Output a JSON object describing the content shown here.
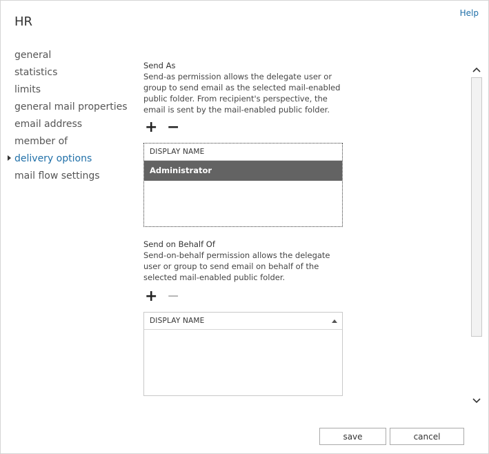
{
  "help_label": "Help",
  "title": "HR",
  "nav": {
    "items": [
      {
        "label": "general"
      },
      {
        "label": "statistics"
      },
      {
        "label": "limits"
      },
      {
        "label": "general mail properties"
      },
      {
        "label": "email address"
      },
      {
        "label": "member of"
      },
      {
        "label": "delivery options"
      },
      {
        "label": "mail flow settings"
      }
    ],
    "active": "delivery options"
  },
  "send_as": {
    "title": "Send As",
    "description": "Send-as permission allows the delegate user or group to send email as the selected mail-enabled public folder. From recipient's perspective, the email is sent by the mail-enabled public folder.",
    "add_glyph": "+",
    "remove_glyph": "−",
    "column_header": "DISPLAY NAME",
    "rows": [
      "Administrator"
    ]
  },
  "send_on_behalf": {
    "title": "Send on Behalf Of",
    "description": "Send-on-behalf permission allows the delegate user or group to send email on behalf of the selected mail-enabled public folder.",
    "add_glyph": "+",
    "remove_glyph": "−",
    "column_header": "DISPLAY NAME",
    "rows": []
  },
  "buttons": {
    "save": "save",
    "cancel": "cancel"
  },
  "colors": {
    "accent": "#1f6fa8",
    "selected_row": "#636363"
  },
  "icons": {
    "scroll_up": "chevron-up-icon",
    "scroll_down": "chevron-down-icon",
    "sort": "sort-ascending-icon"
  }
}
